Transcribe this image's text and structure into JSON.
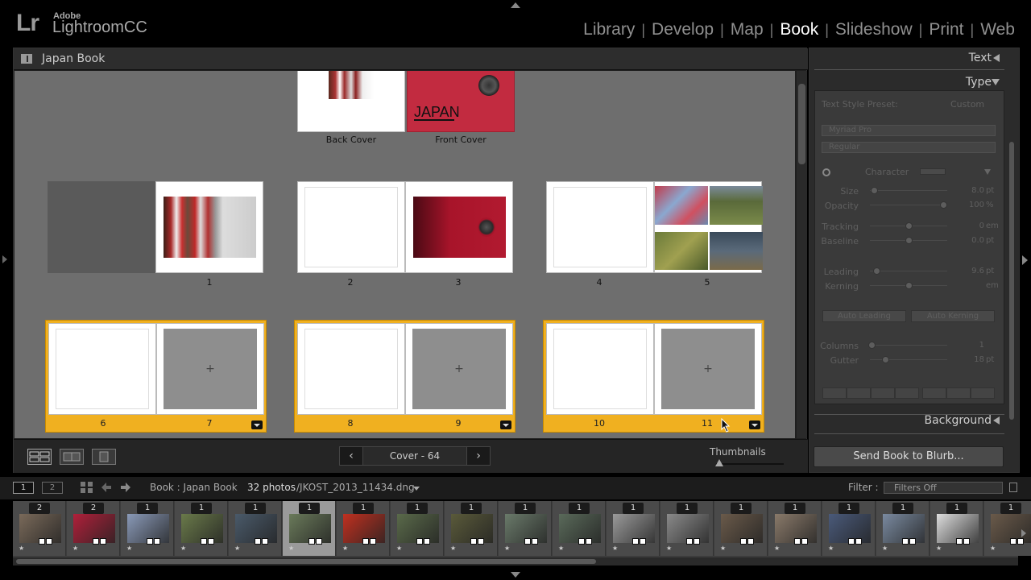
{
  "app": {
    "logo_mark": "Lr",
    "brand": "Adobe",
    "product": "LightroomCC"
  },
  "modules": [
    {
      "label": "Library",
      "active": false
    },
    {
      "label": "Develop",
      "active": false
    },
    {
      "label": "Map",
      "active": false
    },
    {
      "label": "Book",
      "active": true
    },
    {
      "label": "Slideshow",
      "active": false
    },
    {
      "label": "Print",
      "active": false
    },
    {
      "label": "Web",
      "active": false
    }
  ],
  "module_separator": "|",
  "main": {
    "title": "Japan Book",
    "cover": {
      "back_label": "Back Cover",
      "front_label": "Front Cover",
      "front_title": "JAPAN"
    },
    "pages": [
      "1",
      "2",
      "3",
      "4",
      "5",
      "6",
      "7",
      "8",
      "9",
      "10",
      "11"
    ],
    "placeholder_glyph": "+",
    "toolbar": {
      "prev": "‹",
      "next": "›",
      "page_display": "Cover - 64",
      "thumbnails_label": "Thumbnails",
      "thumbnail_size": 0.05
    }
  },
  "right_panel": {
    "text_header": "Text",
    "type_header": "Type",
    "style_preset_label": "Text Style Preset:",
    "style_preset_value": "Custom",
    "font_family": "Myriad Pro",
    "font_style": "Regular",
    "character_label": "Character",
    "sliders": [
      {
        "label": "Size",
        "value": "8.0",
        "unit": "pt",
        "pos": 0.05
      },
      {
        "label": "Opacity",
        "value": "100",
        "unit": "%",
        "pos": 0.95
      },
      {
        "label": "Tracking",
        "value": "0",
        "unit": "em",
        "pos": 0.5
      },
      {
        "label": "Baseline",
        "value": "0.0",
        "unit": "pt",
        "pos": 0.5
      },
      {
        "label": "Leading",
        "value": "9.6",
        "unit": "pt",
        "pos": 0.08
      },
      {
        "label": "Kerning",
        "value": "",
        "unit": "em",
        "pos": 0.5
      },
      {
        "label": "Columns",
        "value": "1",
        "unit": "",
        "pos": 0.02
      },
      {
        "label": "Gutter",
        "value": "18",
        "unit": "pt",
        "pos": 0.2
      }
    ],
    "auto_leading": "Auto Leading",
    "auto_kerning": "Auto Kerning",
    "background_header": "Background",
    "send_button": "Send Book to Blurb..."
  },
  "filmstrip_bar": {
    "window1": "1",
    "window2": "2",
    "source": "Book : Japan Book",
    "count": "32 photos",
    "file": "/JKOST_2013_11434.dng",
    "filter_label": "Filter :",
    "filter_value": "Filters Off"
  },
  "filmstrip": {
    "star": "★",
    "items": [
      {
        "count": "2",
        "color": "#7a6a5a",
        "selected": false
      },
      {
        "count": "2",
        "color": "#b0203a",
        "selected": false
      },
      {
        "count": "1",
        "color": "#8a9ab8",
        "selected": false
      },
      {
        "count": "1",
        "color": "#6a7a4a",
        "selected": false
      },
      {
        "count": "1",
        "color": "#4a5a6a",
        "selected": false
      },
      {
        "count": "1",
        "color": "#6a7a5a",
        "selected": true
      },
      {
        "count": "1",
        "color": "#c03020",
        "selected": false
      },
      {
        "count": "1",
        "color": "#5a6a4a",
        "selected": false
      },
      {
        "count": "1",
        "color": "#5a5a3a",
        "selected": false
      },
      {
        "count": "1",
        "color": "#6a7a6a",
        "selected": false
      },
      {
        "count": "1",
        "color": "#5a6a5a",
        "selected": false
      },
      {
        "count": "1",
        "color": "#9a9a9a",
        "selected": false
      },
      {
        "count": "1",
        "color": "#8a8a8a",
        "selected": false
      },
      {
        "count": "1",
        "color": "#6a5a4a",
        "selected": false
      },
      {
        "count": "1",
        "color": "#8a7a6a",
        "selected": false
      },
      {
        "count": "1",
        "color": "#4a5a7a",
        "selected": false
      },
      {
        "count": "1",
        "color": "#7a8aa0",
        "selected": false
      },
      {
        "count": "1",
        "color": "#dddddd",
        "selected": false
      },
      {
        "count": "1",
        "color": "#6a5a4a",
        "selected": false
      }
    ]
  },
  "colors": {
    "accent_selection": "#f0b020",
    "active_module": "#ffffff"
  }
}
